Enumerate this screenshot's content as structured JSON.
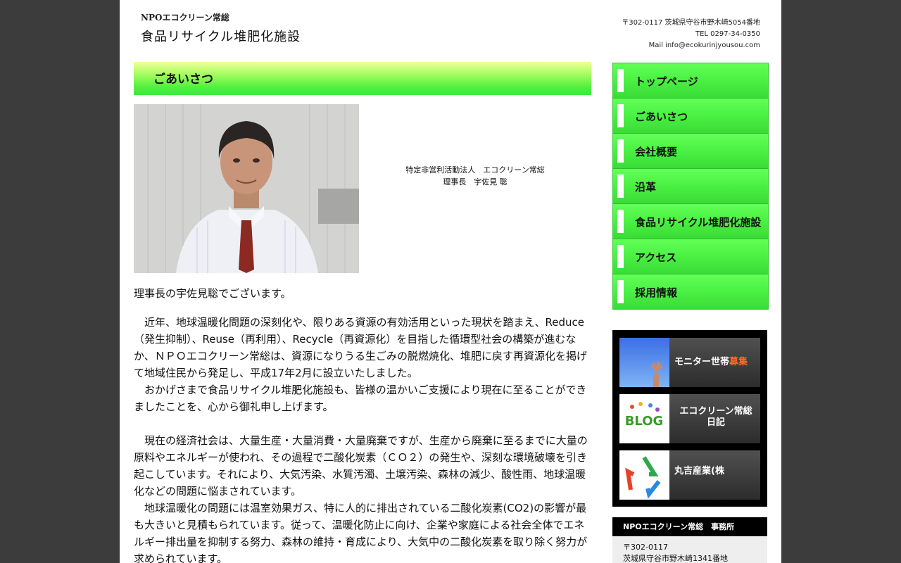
{
  "header": {
    "org": "NPOエコクリーン常総",
    "title": "食品リサイクル堆肥化施設",
    "address": "〒302-0117 茨城県守谷市野木崎5054番地",
    "tel": "TEL 0297-34-0350",
    "mail": "Mail info@ecokurinjyousou.com"
  },
  "main": {
    "heading": "ごあいさつ",
    "caption_line1": "特定非営利活動法人　エコクリーン常総",
    "caption_line2": "理事長　宇佐見 聡",
    "intro": "理事長の宇佐見聡でございます。",
    "paragraphs": [
      "　近年、地球温暖化問題の深刻化や、限りある資源の有効活用といった現状を踏まえ、Reduce（発生抑制）、Reuse（再利用）、Recycle（再資源化）を目指した循環型社会の構築が進むなか、ＮＰＯエコクリーン常総は、資源になりうる生ごみの脱燃焼化、堆肥に戻す再資源化を掲げて地域住民から発足し、平成17年2月に設立いたしました。",
      "　おかげさまで食品リサイクル堆肥化施設も、皆様の温かいご支援により現在に至ることができましたことを、心から御礼申し上げます。",
      "　現在の経済社会は、大量生産・大量消費・大量廃棄ですが、生産から廃棄に至るまでに大量の原料やエネルギーが使われ、その過程で二酸化炭素（ＣＯ２）の発生や、深刻な環境破壊を引き起こしています。それにより、大気汚染、水質汚濁、土壌汚染、森林の減少、酸性雨、地球温暖化などの問題に悩まされています。",
      "　地球温暖化の問題には温室効果ガス、特に人的に排出されている二酸化炭素(CO2)の影響が最も大きいと見積もられています。従って、温暖化防止に向け、企業や家庭による社会全体でエネルギー排出量を抑制する努力、森林の維持・育成により、大気中の二酸化炭素を取り除く努力が求められています。"
    ]
  },
  "nav": {
    "items": [
      {
        "label": "トップページ"
      },
      {
        "label": "ごあいさつ"
      },
      {
        "label": "会社概要"
      },
      {
        "label": "沿革"
      },
      {
        "label": "食品リサイクル堆肥化施設"
      },
      {
        "label": "アクセス"
      },
      {
        "label": "採用情報"
      }
    ]
  },
  "banners": {
    "monitor_pre": "モニター世帯",
    "monitor_hl": "募集",
    "blog_line1": "エコクリーン常総",
    "blog_line2": "日記",
    "blog_thumb": "BLOG",
    "maruyoshi": "丸吉産業(株"
  },
  "office": {
    "title": "NPOエコクリーン常総　事務所",
    "postal": "〒302-0117",
    "address": "茨城県守谷市野木崎1341番地"
  },
  "colors": {
    "nav_green": "#4cf244",
    "heading_green": "#55f03e",
    "highlight": "#ff6a2a"
  }
}
